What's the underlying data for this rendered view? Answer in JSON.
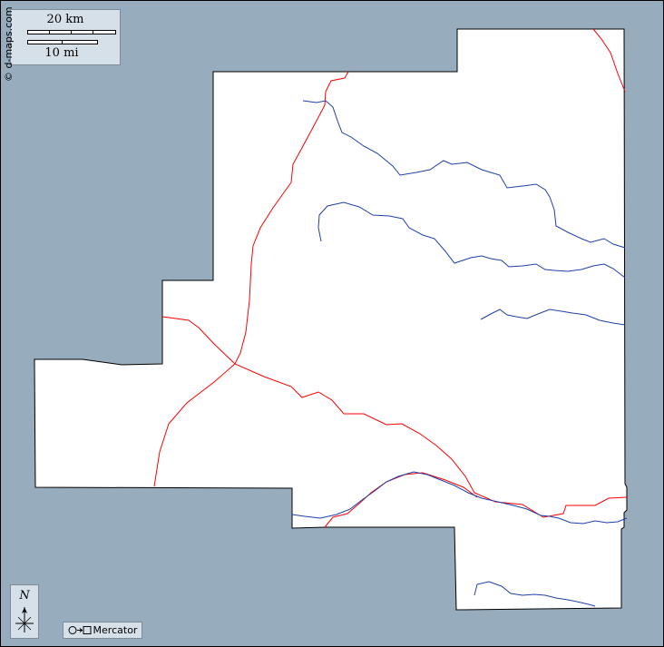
{
  "map": {
    "water_color": "#97acbd",
    "land_color": "#ffffff",
    "road_color": "#ff0000",
    "river_color": "#1f3fa8",
    "scale": {
      "km_label": "20 km",
      "mi_label": "10 mi"
    },
    "credit": "© d-maps.com",
    "north": {
      "label": "N",
      "icon": "compass-rose-icon"
    },
    "projection": {
      "label": "Mercator",
      "icon": "circle-to-square-icon"
    }
  }
}
